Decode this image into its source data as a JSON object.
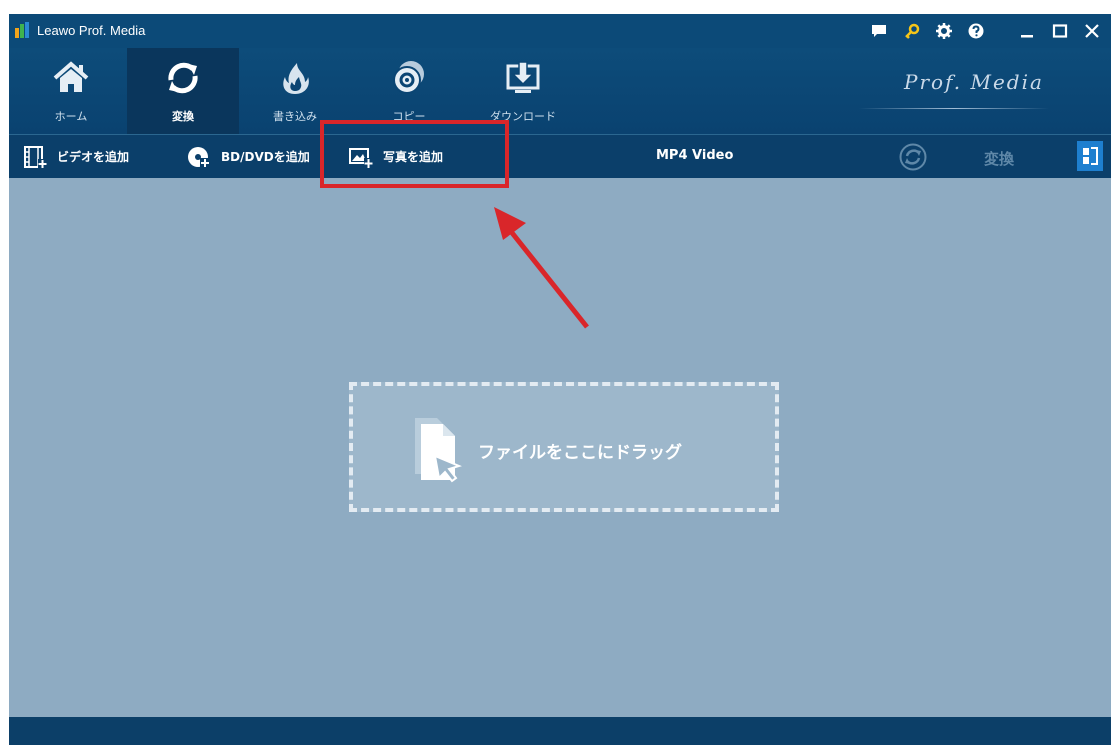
{
  "window": {
    "title": "Leawo Prof. Media"
  },
  "nav": {
    "items": [
      {
        "label": "ホーム",
        "icon": "home-icon"
      },
      {
        "label": "変換",
        "icon": "convert-icon"
      },
      {
        "label": "書き込み",
        "icon": "burn-icon"
      },
      {
        "label": "コピー",
        "icon": "copy-disc-icon"
      },
      {
        "label": "ダウンロード",
        "icon": "download-icon"
      }
    ],
    "active": "変換",
    "brand": "Prof. Media"
  },
  "toolbar": {
    "add_video": "ビデオを追加",
    "add_bd_dvd": "BD/DVDを追加",
    "add_photo": "写真を追加",
    "format": "MP4 Video",
    "convert": "変換"
  },
  "dropzone": {
    "text": "ファイルをここにドラッグ"
  },
  "colors": {
    "titlebar": "#0c4a78",
    "toolbar": "#0b3f6a",
    "content": "#8eabc2",
    "highlight": "#d9262a",
    "arrow": "#d9262a",
    "panel_toggle": "#1e7fcf"
  }
}
